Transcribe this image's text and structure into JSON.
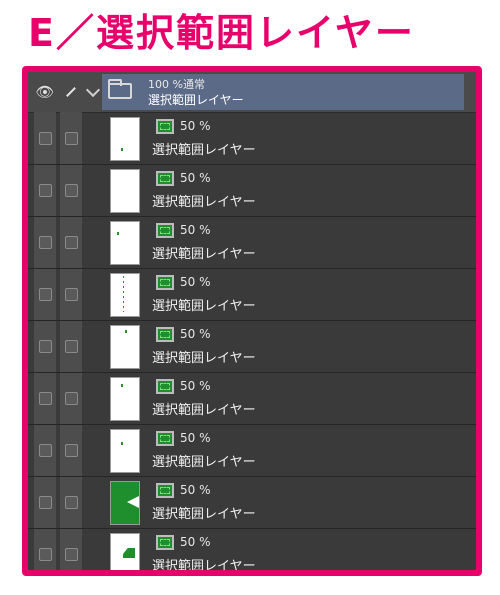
{
  "heading": "E／選択範囲レイヤー",
  "colors": {
    "accent": "#e8006b",
    "panel": "#3a3a3a",
    "selected": "#5b6a87",
    "mask": "#1f8f2e"
  },
  "header": {
    "eye_icon": "eye-icon",
    "pen_icon": "pen-icon"
  },
  "folder": {
    "blend": "100 %通常",
    "name": "選択範囲レイヤー",
    "icon": "folder-icon"
  },
  "layers": [
    {
      "opacity": "50 %",
      "name": "選択範囲レイヤー",
      "thumb": "dot"
    },
    {
      "opacity": "50 %",
      "name": "選択範囲レイヤー",
      "thumb": "blank"
    },
    {
      "opacity": "50 %",
      "name": "選択範囲レイヤー",
      "thumb": "dot"
    },
    {
      "opacity": "50 %",
      "name": "選択範囲レイヤー",
      "thumb": "dotted-line"
    },
    {
      "opacity": "50 %",
      "name": "選択範囲レイヤー",
      "thumb": "dot"
    },
    {
      "opacity": "50 %",
      "name": "選択範囲レイヤー",
      "thumb": "dot"
    },
    {
      "opacity": "50 %",
      "name": "選択範囲レイヤー",
      "thumb": "dot"
    },
    {
      "opacity": "50 %",
      "name": "選択範囲レイヤー",
      "thumb": "green-block"
    },
    {
      "opacity": "50 %",
      "name": "選択範囲レイヤー",
      "thumb": "green-corner"
    }
  ]
}
